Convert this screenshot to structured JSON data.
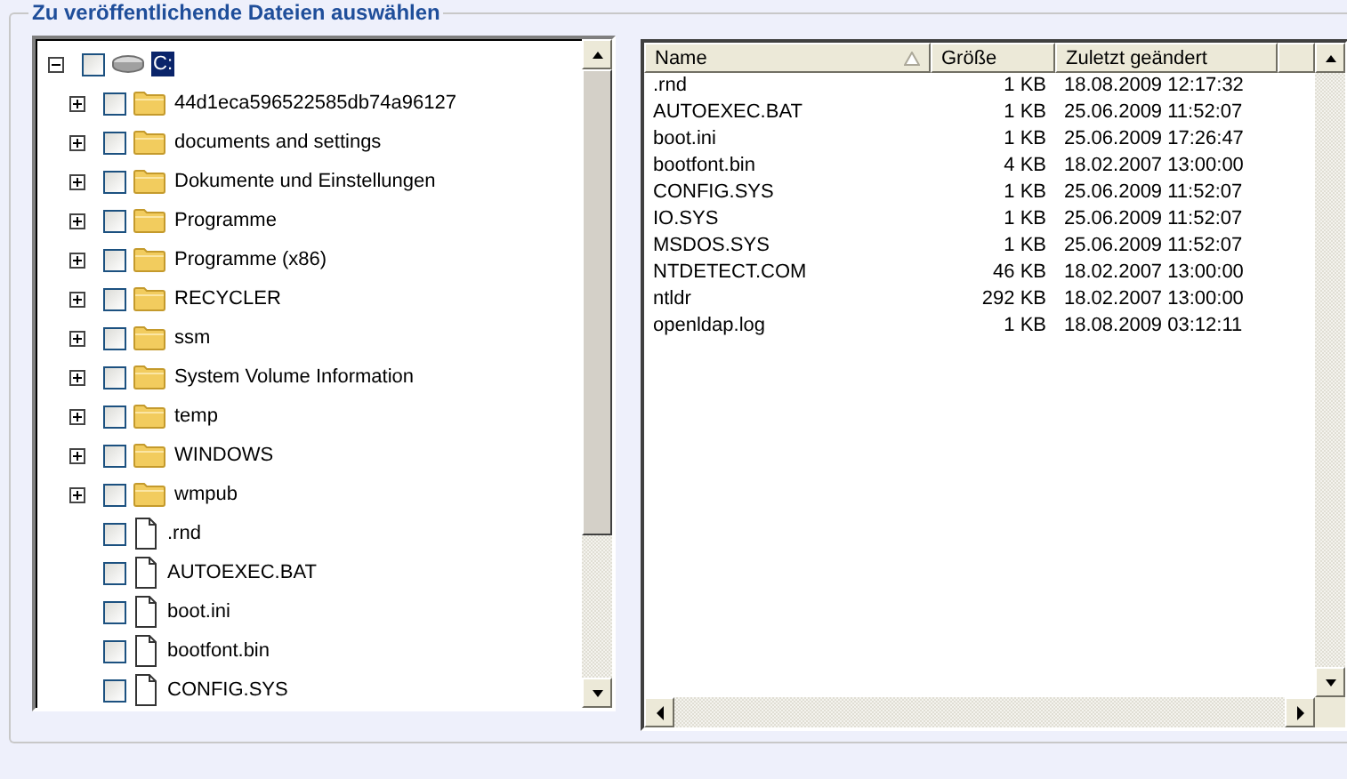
{
  "group": {
    "title": "Zu veröffentlichende Dateien auswählen"
  },
  "tree": {
    "root": {
      "label": "C:",
      "kind": "drive",
      "expanded": true,
      "checked": false,
      "selected": true,
      "children": [
        {
          "label": "44d1eca596522585db74a96127",
          "kind": "folder",
          "expanded": false,
          "checked": false,
          "selected": false
        },
        {
          "label": "documents and settings",
          "kind": "folder",
          "expanded": false,
          "checked": false,
          "selected": false
        },
        {
          "label": "Dokumente und Einstellungen",
          "kind": "folder",
          "expanded": false,
          "checked": false,
          "selected": false
        },
        {
          "label": "Programme",
          "kind": "folder",
          "expanded": false,
          "checked": false,
          "selected": false
        },
        {
          "label": "Programme (x86)",
          "kind": "folder",
          "expanded": false,
          "checked": false,
          "selected": false
        },
        {
          "label": "RECYCLER",
          "kind": "folder",
          "expanded": false,
          "checked": false,
          "selected": false
        },
        {
          "label": "ssm",
          "kind": "folder",
          "expanded": false,
          "checked": false,
          "selected": false
        },
        {
          "label": "System Volume Information",
          "kind": "folder",
          "expanded": false,
          "checked": false,
          "selected": false
        },
        {
          "label": "temp",
          "kind": "folder",
          "expanded": false,
          "checked": false,
          "selected": false
        },
        {
          "label": "WINDOWS",
          "kind": "folder",
          "expanded": false,
          "checked": false,
          "selected": false
        },
        {
          "label": "wmpub",
          "kind": "folder",
          "expanded": false,
          "checked": false,
          "selected": false
        },
        {
          "label": ".rnd",
          "kind": "file",
          "checked": false,
          "selected": false
        },
        {
          "label": "AUTOEXEC.BAT",
          "kind": "file",
          "checked": false,
          "selected": false
        },
        {
          "label": "boot.ini",
          "kind": "file",
          "checked": false,
          "selected": false
        },
        {
          "label": "bootfont.bin",
          "kind": "file",
          "checked": false,
          "selected": false
        },
        {
          "label": "CONFIG.SYS",
          "kind": "file",
          "checked": false,
          "selected": false
        }
      ]
    }
  },
  "list": {
    "columns": [
      {
        "label": "Name",
        "sorted": true
      },
      {
        "label": "Größe",
        "sorted": false
      },
      {
        "label": "Zuletzt geändert",
        "sorted": false
      }
    ],
    "rows": [
      {
        "name": ".rnd",
        "size": "1 KB",
        "modified": "18.08.2009 12:17:32"
      },
      {
        "name": "AUTOEXEC.BAT",
        "size": "1 KB",
        "modified": "25.06.2009 11:52:07"
      },
      {
        "name": "boot.ini",
        "size": "1 KB",
        "modified": "25.06.2009 17:26:47"
      },
      {
        "name": "bootfont.bin",
        "size": "4 KB",
        "modified": "18.02.2007 13:00:00"
      },
      {
        "name": "CONFIG.SYS",
        "size": "1 KB",
        "modified": "25.06.2009 11:52:07"
      },
      {
        "name": "IO.SYS",
        "size": "1 KB",
        "modified": "25.06.2009 11:52:07"
      },
      {
        "name": "MSDOS.SYS",
        "size": "1 KB",
        "modified": "25.06.2009 11:52:07"
      },
      {
        "name": "NTDETECT.COM",
        "size": "46 KB",
        "modified": "18.02.2007 13:00:00"
      },
      {
        "name": "ntldr",
        "size": "292 KB",
        "modified": "18.02.2007 13:00:00"
      },
      {
        "name": "openldap.log",
        "size": "1 KB",
        "modified": "18.08.2009 03:12:11"
      }
    ]
  }
}
